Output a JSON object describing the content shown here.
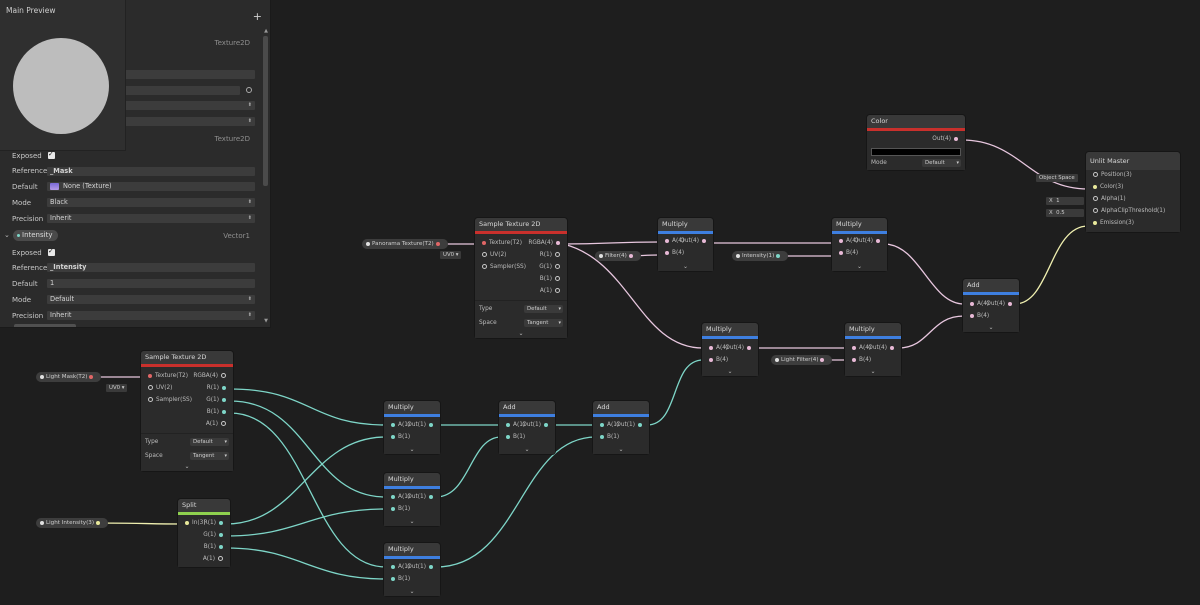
{
  "preview": {
    "title": "Main Preview"
  },
  "blackboard": {
    "add_glyph": "+",
    "mask_type": "Texture2D",
    "mask_type2": "Texture2D",
    "mask": {
      "exposed_label": "Exposed",
      "reference_label": "Reference",
      "reference_value": "_Mask",
      "default_label": "Default",
      "default_value": "None (Texture)",
      "mode_label": "Mode",
      "mode_value": "Black",
      "precision_label": "Precision",
      "precision_value": "Inherit"
    },
    "intensity": {
      "name": "Intensity",
      "type": "Vector1",
      "exposed_label": "Exposed",
      "reference_label": "Reference",
      "reference_value": "_Intensity",
      "default_label": "Default",
      "default_value": "1",
      "mode_label": "Mode",
      "mode_value": "Default",
      "precision_label": "Precision",
      "precision_value": "Inherit"
    }
  },
  "nodes": {
    "sample_tex_1": {
      "title": "Sample Texture 2D",
      "inputs": [
        "Texture(T2)",
        "UV(2)",
        "Sampler(SS)"
      ],
      "outputs": [
        "RGBA(4)",
        "R(1)",
        "G(1)",
        "B(1)",
        "A(1)"
      ],
      "type_label": "Type",
      "type_value": "Default",
      "space_label": "Space",
      "space_value": "Tangent"
    },
    "sample_tex_2": {
      "title": "Sample Texture 2D",
      "inputs": [
        "Texture(T2)",
        "UV(2)",
        "Sampler(SS)"
      ],
      "outputs": [
        "RGBA(4)",
        "R(1)",
        "G(1)",
        "B(1)",
        "A(1)"
      ],
      "type_label": "Type",
      "type_value": "Default",
      "space_label": "Space",
      "space_value": "Tangent"
    },
    "color": {
      "title": "Color",
      "out": "Out(4)",
      "mode_label": "Mode",
      "mode_value": "Default"
    },
    "unlit_master": {
      "title": "Unlit Master",
      "inputs": [
        "Position(3)",
        "Color(3)",
        "Alpha(1)",
        "AlphaClipThreshold(1)",
        "Emission(3)"
      ]
    },
    "multiply_1": {
      "title": "Multiply",
      "a": "A(4)",
      "b": "B(4)",
      "out": "Out(4)"
    },
    "multiply_2": {
      "title": "Multiply",
      "a": "A(4)",
      "b": "B(4)",
      "out": "Out(4)"
    },
    "multiply_3": {
      "title": "Multiply",
      "a": "A(4)",
      "b": "B(4)",
      "out": "Out(4)"
    },
    "multiply_4": {
      "title": "Multiply",
      "a": "A(4)",
      "b": "B(4)",
      "out": "Out(4)"
    },
    "add_1": {
      "title": "Add",
      "a": "A(4)",
      "b": "B(4)",
      "out": "Out(4)"
    },
    "mul_low_1": {
      "title": "Multiply",
      "a": "A(1)",
      "b": "B(1)",
      "out": "Out(1)"
    },
    "mul_low_2": {
      "title": "Multiply",
      "a": "A(1)",
      "b": "B(1)",
      "out": "Out(1)"
    },
    "mul_low_3": {
      "title": "Multiply",
      "a": "A(1)",
      "b": "B(1)",
      "out": "Out(1)"
    },
    "add_low_1": {
      "title": "Add",
      "a": "A(1)",
      "b": "B(1)",
      "out": "Out(1)"
    },
    "add_low_2": {
      "title": "Add",
      "a": "A(1)",
      "b": "B(1)",
      "out": "Out(1)"
    },
    "split": {
      "title": "Split",
      "in": "In(3)",
      "outputs": [
        "R(1)",
        "G(1)",
        "B(1)",
        "A(1)"
      ]
    }
  },
  "pills": {
    "panorama": "Panorama Texture(T2)",
    "light_mask": "Light Mask(T2)",
    "light_intensity": "Light Intensity(3)",
    "filter": "Filter(4)",
    "intensity": "Intensity(1)",
    "light_filter": "Light Filter(4)"
  },
  "tags": {
    "uv0_a": "UV0 ▾",
    "uv0_b": "UV0 ▾",
    "object_space": "Object Space",
    "alpha_x": "X",
    "alpha_val": "1",
    "clip_x": "X",
    "clip_val": "0.5"
  },
  "colors": {
    "canvas": "#1e1e1e",
    "texture_header": "#c9302c",
    "math_header": "#3e7fe0",
    "split_header": "#8fd14f",
    "wire_vec4": "#e8c7df",
    "wire_vec1": "#7ed6c8",
    "wire_vec3": "#f0f0b0"
  }
}
